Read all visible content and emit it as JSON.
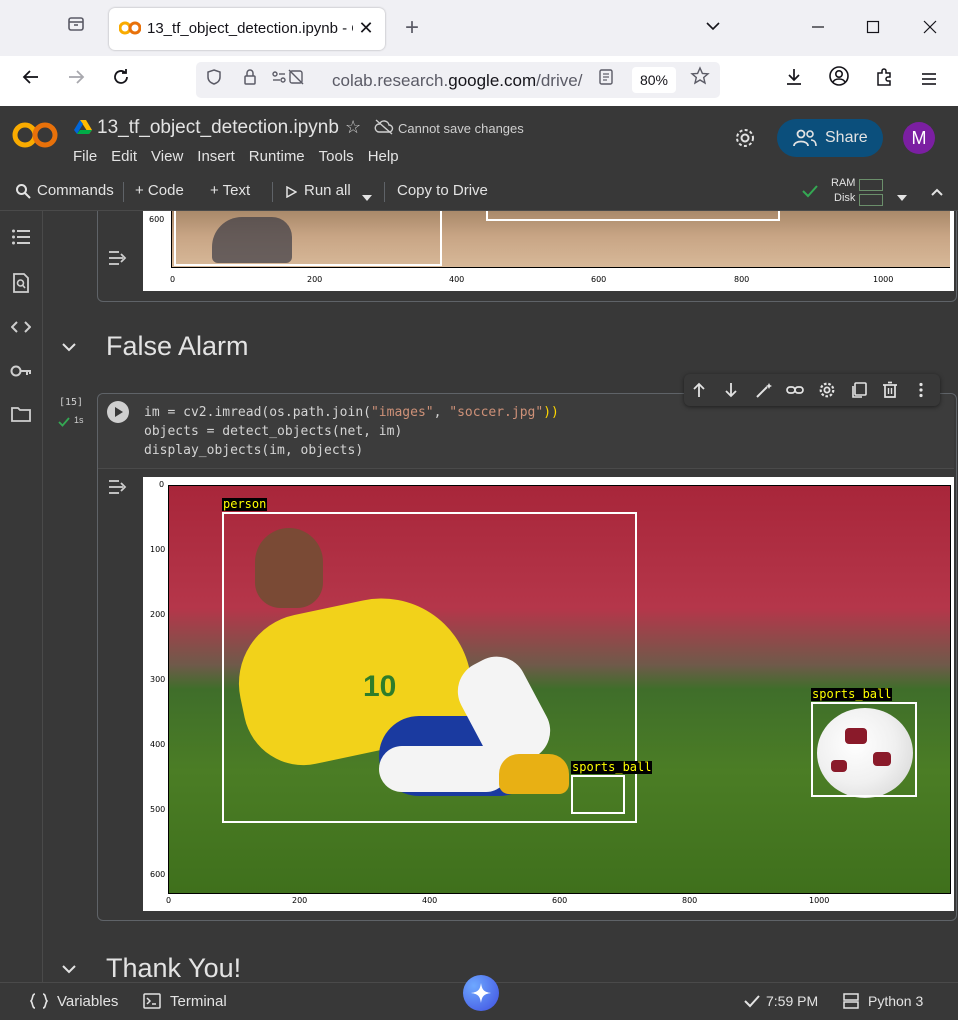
{
  "browser": {
    "tab_title": "13_tf_object_detection.ipynb - C",
    "url_prefix": "colab.research.",
    "url_domain": "google.com",
    "url_suffix": "/drive/",
    "zoom": "80%"
  },
  "colab": {
    "notebook_title": "13_tf_object_detection.ipynb",
    "save_status": "Cannot save changes",
    "share_label": "Share",
    "avatar_letter": "M",
    "menu": [
      "File",
      "Edit",
      "View",
      "Insert",
      "Runtime",
      "Tools",
      "Help"
    ],
    "toolbar": {
      "commands": "Commands",
      "code": "+ Code",
      "text": "+ Text",
      "run_all": "Run all",
      "copy_to_drive": "Copy to Drive",
      "ram": "RAM",
      "disk": "Disk"
    }
  },
  "notebook": {
    "prev_output_ticks": [
      "0",
      "200",
      "400",
      "600",
      "800",
      "1000"
    ],
    "prev_output_y_tick": "600",
    "section1_title": "False Alarm",
    "cell": {
      "exec_count": "[15]",
      "exec_time": "1s",
      "code_lines": [
        {
          "a": "im = cv2.imread(os.path.join(",
          "s1": "\"images\"",
          "b": ", ",
          "s2": "\"soccer.jpg\"",
          "c": "))"
        },
        {
          "a": "objects = detect_objects(net, im)"
        },
        {
          "a": "display_objects(im, objects)"
        }
      ]
    },
    "plot": {
      "x_ticks": [
        "0",
        "200",
        "400",
        "600",
        "800",
        "1000"
      ],
      "y_ticks": [
        "0",
        "100",
        "200",
        "300",
        "400",
        "500",
        "600"
      ],
      "detections": [
        {
          "label": "person"
        },
        {
          "label": "sports_ball"
        },
        {
          "label": "sports_ball"
        }
      ],
      "jersey_number": "10"
    },
    "section2_title": "Thank You!"
  },
  "statusbar": {
    "variables": "Variables",
    "terminal": "Terminal",
    "time": "7:59 PM",
    "runtime": "Python 3"
  }
}
